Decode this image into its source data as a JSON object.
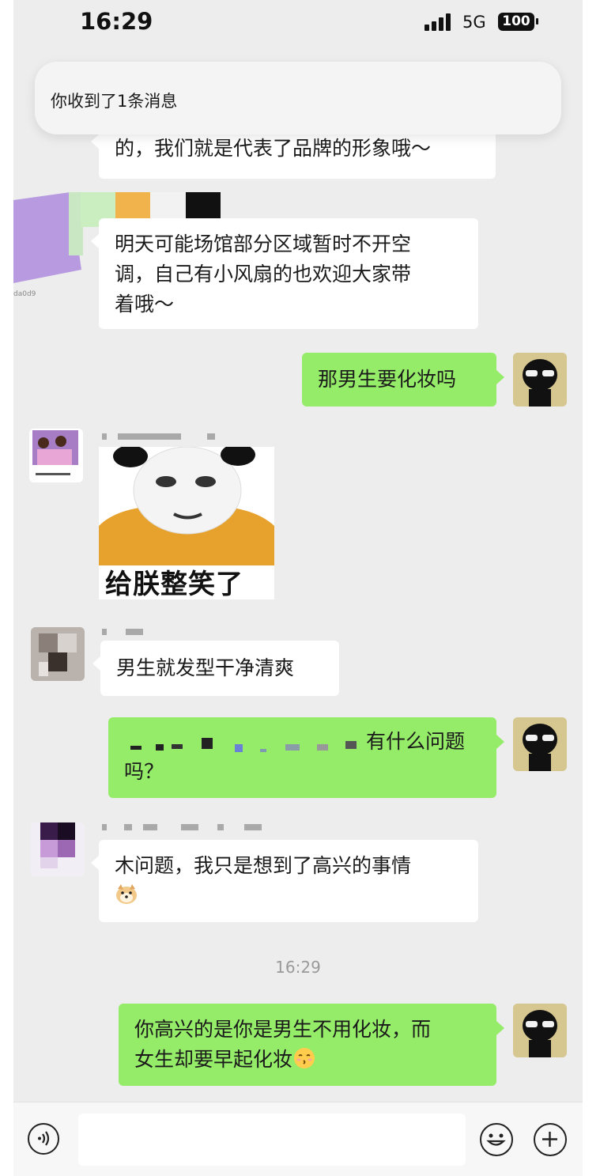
{
  "status_bar": {
    "time": "16:29",
    "network": "5G",
    "battery": "100"
  },
  "notification": {
    "text": "你收到了1条消息"
  },
  "messages": [
    {
      "side": "left",
      "lines": [
        "的，我们就是代表了品牌的形象哦～"
      ]
    },
    {
      "side": "left",
      "lines": [
        "明天可能场馆部分区域暂时不开空",
        "调，自己有小风扇的也欢迎大家带",
        "着哦～"
      ]
    },
    {
      "side": "right",
      "lines": [
        "那男生要化妆吗"
      ]
    },
    {
      "side": "left",
      "type": "sticker",
      "caption": "给朕整笑了"
    },
    {
      "side": "left",
      "lines": [
        "男生就发型干净清爽"
      ]
    },
    {
      "side": "right",
      "lines": [
        "有什么问题",
        "吗？"
      ]
    },
    {
      "side": "left",
      "lines": [
        "木问题，我只是想到了高兴的事情"
      ],
      "emoji": "doge-icon"
    },
    {
      "side": "right",
      "lines": [
        "你高兴的是你是男生不用化妆，而",
        "女生却要早起化妆"
      ],
      "emoji": "kissing-face-icon"
    }
  ],
  "partial_avatar_text": "da0d9",
  "timestamp": "16:29",
  "input_bar": {
    "voice_icon": "voice-icon",
    "emoji_icon": "emoji-icon",
    "plus_icon": "plus-icon"
  },
  "colors": {
    "background": "#ededed",
    "bubble_left": "#ffffff",
    "bubble_right": "#95ec69"
  }
}
